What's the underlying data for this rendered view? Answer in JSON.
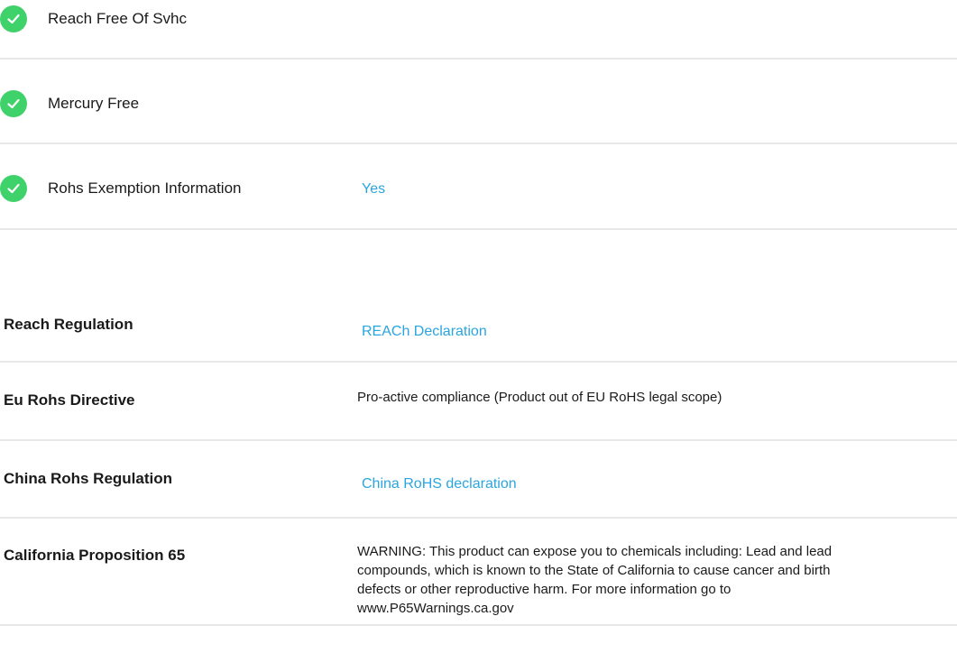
{
  "checklist": {
    "items": [
      {
        "label": "Reach Free Of Svhc",
        "icon": "check-circle-icon"
      },
      {
        "label": "Mercury Free",
        "icon": "check-circle-icon"
      },
      {
        "label": "Rohs Exemption Information",
        "icon": "check-circle-icon",
        "value": "Yes"
      }
    ]
  },
  "regulations": {
    "rows": [
      {
        "label": "Reach Regulation",
        "value": "REACh Declaration"
      },
      {
        "label": "Eu Rohs Directive",
        "value": "Pro-active compliance (Product out of EU RoHS legal scope)"
      },
      {
        "label": "China Rohs Regulation",
        "value": "China RoHS declaration"
      },
      {
        "label": "California Proposition 65",
        "value_lines": [
          "WARNING: This product can expose you to chemicals including: Lead and lead",
          "compounds, which is known to the State of California to cause cancer and birth",
          "defects or other reproductive harm. For more information go to",
          "www.P65Warnings.ca.gov"
        ]
      }
    ]
  },
  "colors": {
    "check": "#3fd26a",
    "link": "#2aa5e0",
    "divider": "#e8e8e8"
  }
}
